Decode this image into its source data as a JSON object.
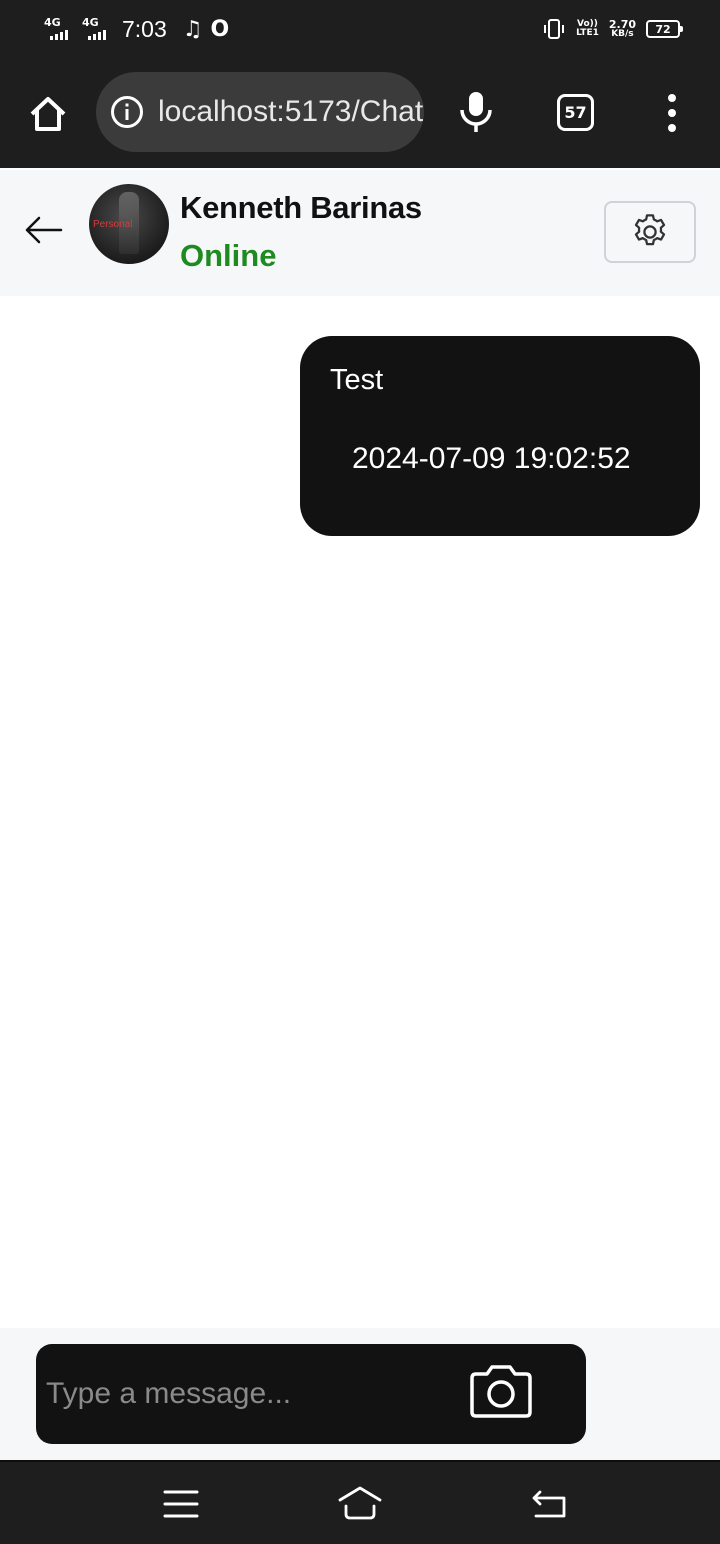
{
  "status_bar": {
    "network_1": "4G",
    "network_2": "4G",
    "time": "7:03",
    "volte_top": "Vo))",
    "volte_bottom": "LTE1",
    "speed_value": "2.70",
    "speed_unit": "KB/s",
    "battery": "72",
    "icons": [
      "music-note-icon",
      "opera-icon",
      "vibrate-icon"
    ]
  },
  "browser": {
    "url": "localhost:5173/Chat",
    "tab_count": "57",
    "icons": [
      "home-icon",
      "info-icon",
      "mic-icon",
      "more-vert-icon"
    ]
  },
  "chat_header": {
    "contact_name": "Kenneth Barinas",
    "status": "Online",
    "avatar_text": "Personal",
    "status_color": "#1f8a1f",
    "icons": [
      "back-arrow-icon",
      "gear-icon"
    ]
  },
  "messages": [
    {
      "text": "Test",
      "timestamp": "2024-07-09 19:02:52",
      "sender": "self"
    }
  ],
  "composer": {
    "placeholder": "Type a message...",
    "value": "",
    "icons": [
      "camera-icon"
    ]
  },
  "nav_bar": {
    "icons": [
      "menu-lines-icon",
      "home-outline-icon",
      "back-return-icon"
    ]
  },
  "colors": {
    "system_bar": "#1e1e1e",
    "bubble": "#121212",
    "header_bg": "#f6f7f9",
    "online_green": "#1f8a1f"
  }
}
